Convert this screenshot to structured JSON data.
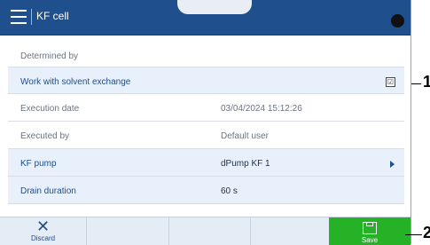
{
  "header": {
    "title": "KF cell"
  },
  "rows": [
    {
      "label": "Determined by",
      "value": ""
    },
    {
      "label": "Work with solvent exchange",
      "value": "",
      "checkbox": "☑"
    },
    {
      "label": "Execution date",
      "value": "03/04/2024  15:12:26"
    },
    {
      "label": "Executed by",
      "value": "Default user"
    },
    {
      "label": "KF pump",
      "value": "dPump KF 1"
    },
    {
      "label": "Drain duration",
      "value": "60 s"
    }
  ],
  "footer": {
    "discard_label": "Discard",
    "save_label": "Save"
  },
  "callouts": [
    "1",
    "2"
  ],
  "colors": {
    "header": "#1f4f8c",
    "row_highlight": "#e7f0fb",
    "save": "#26b227"
  }
}
